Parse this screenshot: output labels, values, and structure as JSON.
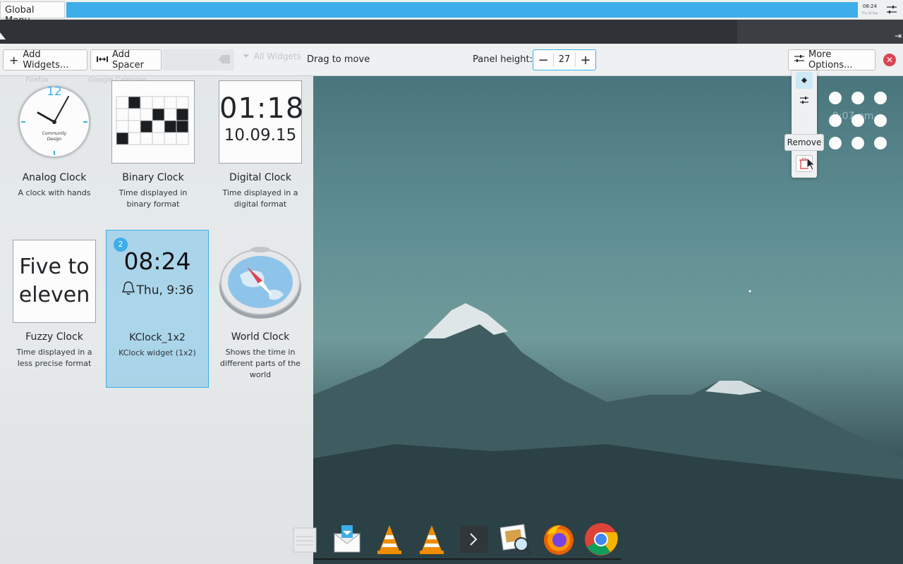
{
  "top_bar": {
    "global_menu_label": "Global Menu",
    "clock_time": "08:24",
    "clock_sub": "Thu 10 Sep"
  },
  "toolbar": {
    "add_widgets_label": "Add Widgets...",
    "add_spacer_label": "Add Spacer",
    "filter_label": "All Widgets",
    "drag_label": "Drag to move",
    "panel_height_label": "Panel height:",
    "panel_height_value": "27",
    "more_options_label": "More Options...",
    "accent": "#3daee9",
    "close_color": "#da4453"
  },
  "explorer": {
    "faded_labels": [
      "Firefox",
      "Google Calendar"
    ],
    "widgets": [
      {
        "name": "Analog Clock",
        "desc": "A clock with hands",
        "dial_label": "Community Design",
        "twelve": "12"
      },
      {
        "name": "Binary Clock",
        "desc": "Time displayed in binary format"
      },
      {
        "name": "Digital Clock",
        "desc": "Time displayed in a digital format",
        "time": "01:18",
        "date": "10.09.15"
      },
      {
        "name": "Fuzzy Clock",
        "desc": "Time displayed in a less precise format",
        "line1": "Five to",
        "line2": "eleven"
      },
      {
        "name": "KClock_1x2",
        "desc": "KClock widget (1x2)",
        "time": "08:24",
        "alarm": "Thu, 9:36",
        "badge": "2",
        "selected": true
      },
      {
        "name": "World Clock",
        "desc": "Shows the time in different parts of the world"
      }
    ]
  },
  "applet_handle": {
    "remove_tooltip": "Remove",
    "ghost_time": "9:07 pm"
  },
  "dock": {
    "items": [
      "text-editor-icon",
      "mail-icon",
      "vlc-icon",
      "vlc-icon",
      "terminal-icon",
      "image-viewer-icon",
      "firefox-icon",
      "chrome-icon"
    ]
  }
}
